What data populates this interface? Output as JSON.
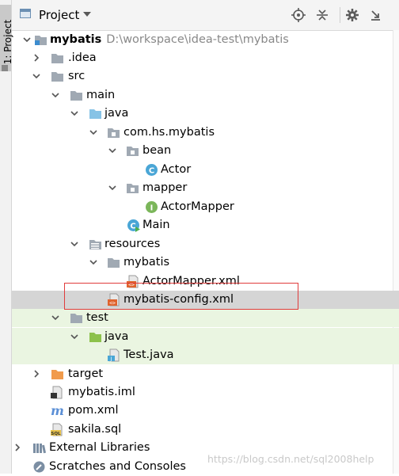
{
  "tool_strip": {
    "tab_label": "1: Project"
  },
  "header": {
    "title": "Project",
    "buttons": [
      "locate-icon",
      "collapse-icon",
      "settings-icon",
      "hide-icon"
    ]
  },
  "tree": [
    {
      "id": "mybatis",
      "label": "mybatis",
      "path": "D:\\workspace\\idea-test\\mybatis",
      "icon": "module-folder-icon",
      "expanded": true
    },
    {
      "id": "idea",
      "label": ".idea",
      "icon": "folder-icon",
      "expanded": false
    },
    {
      "id": "src",
      "label": "src",
      "icon": "folder-icon",
      "expanded": true
    },
    {
      "id": "main",
      "label": "main",
      "icon": "folder-icon",
      "expanded": true
    },
    {
      "id": "java-main",
      "label": "java",
      "icon": "source-folder-icon",
      "expanded": true
    },
    {
      "id": "package",
      "label": "com.hs.mybatis",
      "icon": "package-icon",
      "expanded": true
    },
    {
      "id": "bean",
      "label": "bean",
      "icon": "package-icon",
      "expanded": true
    },
    {
      "id": "actor",
      "label": "Actor",
      "icon": "class-icon"
    },
    {
      "id": "mapper",
      "label": "mapper",
      "icon": "package-icon",
      "expanded": true
    },
    {
      "id": "actormapper",
      "label": "ActorMapper",
      "icon": "interface-icon"
    },
    {
      "id": "main-class",
      "label": "Main",
      "icon": "main-class-icon"
    },
    {
      "id": "resources",
      "label": "resources",
      "icon": "resources-folder-icon",
      "expanded": true
    },
    {
      "id": "mybatis-res",
      "label": "mybatis",
      "icon": "folder-icon",
      "expanded": true
    },
    {
      "id": "actormapper-xml",
      "label": "ActorMapper.xml",
      "icon": "xml-file-icon"
    },
    {
      "id": "config-xml",
      "label": "mybatis-config.xml",
      "icon": "xml-file-icon",
      "selected": true
    },
    {
      "id": "test",
      "label": "test",
      "icon": "folder-icon",
      "expanded": true
    },
    {
      "id": "java-test",
      "label": "java",
      "icon": "test-folder-icon",
      "expanded": true
    },
    {
      "id": "testjava",
      "label": "Test.java",
      "icon": "java-file-icon"
    },
    {
      "id": "target",
      "label": "target",
      "icon": "excluded-folder-icon",
      "expanded": false
    },
    {
      "id": "iml",
      "label": "mybatis.iml",
      "icon": "iml-file-icon"
    },
    {
      "id": "pom",
      "label": "pom.xml",
      "icon": "maven-icon"
    },
    {
      "id": "sql",
      "label": "sakila.sql",
      "icon": "sql-file-icon"
    },
    {
      "id": "extlib",
      "label": "External Libraries",
      "icon": "libraries-icon",
      "expanded": false
    },
    {
      "id": "scratch",
      "label": "Scratches and Consoles",
      "icon": "scratches-icon"
    }
  ],
  "watermark": "https://blog.csdn.net/sql2008help",
  "colors": {
    "selection": "#d5d5d5",
    "test_row": "#eaf5e1",
    "highlight_border": "#e03c3c",
    "folder": "#a0a9b3",
    "source_folder": "#87c3e6",
    "test_folder": "#8cc14b",
    "excluded_folder": "#f19b4c",
    "class": "#4aa6d6",
    "interface": "#7bb65a"
  }
}
